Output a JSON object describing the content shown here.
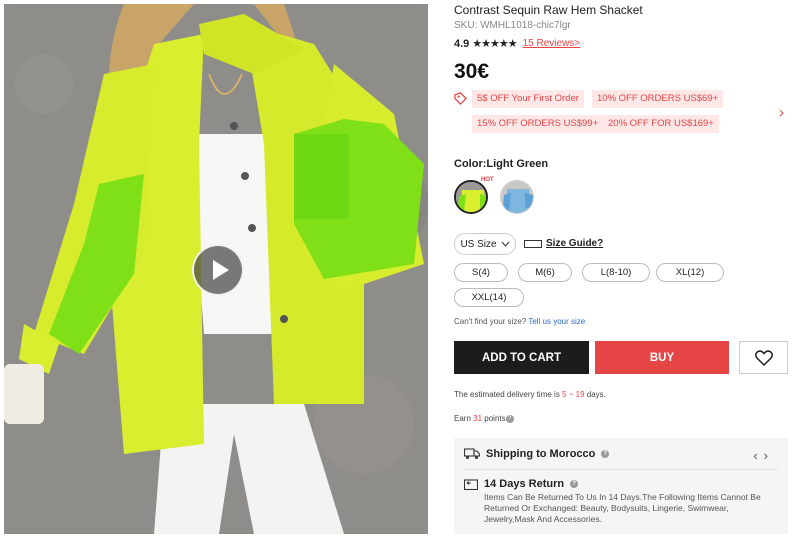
{
  "product": {
    "title": "Contrast Sequin Raw Hem Shacket",
    "sku": "SKU: WMHL1018-chic7lgr",
    "rating": "4.9",
    "stars": "★★★★★",
    "reviews": "15 Reviews>",
    "price": "30€"
  },
  "coupons": [
    "5$ OFF Your First Order",
    "10% OFF ORDERS US$69+",
    "15% OFF ORDERS US$99+",
    "20% OFF FOR US$169+"
  ],
  "color": {
    "label": "Color:Light Green",
    "hot_tag": "HOT",
    "swatches": [
      "Light Green",
      "Blue"
    ]
  },
  "size": {
    "selector": "US Size",
    "guide": "Size Guide?",
    "options": [
      "S(4)",
      "M(6)",
      "L(8-10)",
      "XL(12)",
      "XXL(14)"
    ],
    "cant_find": "Can't find your size?",
    "tell_us": "Tell us your size"
  },
  "actions": {
    "add_to_cart": "ADD TO CART",
    "buy": "BUY"
  },
  "delivery": {
    "prefix": "The estimated delivery time is",
    "range": "5 ~ 19",
    "suffix": "days."
  },
  "points": {
    "prefix": "Earn",
    "value": "31",
    "suffix": "points"
  },
  "shipping": {
    "title": "Shipping to Morocco",
    "return_title": "14 Days Return",
    "return_text": "Items Can Be Returned To Us In 14 Days.The Following Items Cannot Be Returned Or Exchanged: Beauty, Bodysuits, Lingerie, Swimwear, Jewelry,Mask And Accessories."
  },
  "colors": {
    "accent": "#e64545",
    "coupon_bg": "#fde7e7",
    "cart_bg": "#1c1c1c",
    "jacket": "#d9ee2f",
    "sequin": "#7fe018"
  },
  "icons": [
    "play-icon",
    "coupon-tag-icon",
    "chevron-right-icon",
    "chevron-down-icon",
    "ruler-icon",
    "heart-icon",
    "truck-icon",
    "return-icon",
    "question-icon",
    "chevron-left-icon"
  ]
}
